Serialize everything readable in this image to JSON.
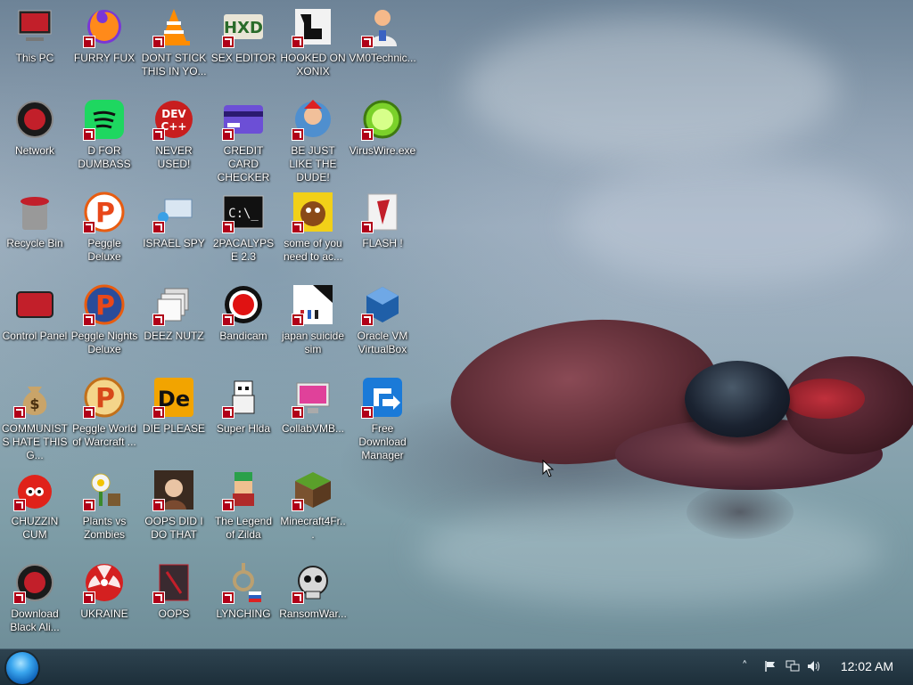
{
  "desktop": {
    "icons": [
      {
        "label": "This PC",
        "icon": "computer-icon"
      },
      {
        "label": "FURRY FUX",
        "icon": "firefox-icon"
      },
      {
        "label": "DONT STICK THIS IN YO...",
        "icon": "vlc-cone-icon"
      },
      {
        "label": "SEX EDITOR",
        "icon": "hxd-editor-icon"
      },
      {
        "label": "HOOKED ON XONIX",
        "icon": "xonix-game-icon"
      },
      {
        "label": "VM0Technic...",
        "icon": "technician-person-icon"
      },
      {
        "label": "Network",
        "icon": "network-orb-icon"
      },
      {
        "label": "D FOR DUMBASS",
        "icon": "spotify-icon"
      },
      {
        "label": "NEVER USED!",
        "icon": "devcpp-icon"
      },
      {
        "label": "CREDIT CARD CHECKER",
        "icon": "credit-card-icon"
      },
      {
        "label": "BE JUST LIKE THE DUDE!",
        "icon": "bonzi-globe-icon"
      },
      {
        "label": "VirusWire.exe",
        "icon": "limewire-icon"
      },
      {
        "label": "Recycle Bin",
        "icon": "recycle-bin-icon"
      },
      {
        "label": "Peggle Deluxe",
        "icon": "peggle-icon"
      },
      {
        "label": "ISRAEL SPY",
        "icon": "remote-desktop-icon"
      },
      {
        "label": "2PACALYPSE 2.3",
        "icon": "terminal-icon"
      },
      {
        "label": "some of you need to ac...",
        "icon": "dog-icon"
      },
      {
        "label": "FLASH !",
        "icon": "flash-icon"
      },
      {
        "label": "Control Panel",
        "icon": "control-panel-icon"
      },
      {
        "label": "Peggle Nights Deluxe",
        "icon": "peggle-nights-icon"
      },
      {
        "label": "DEEZ NUTZ",
        "icon": "windows-stack-icon"
      },
      {
        "label": "Bandicam",
        "icon": "bandicam-icon"
      },
      {
        "label": "japan suicide sim",
        "icon": "game-cover-icon"
      },
      {
        "label": "Oracle VM VirtualBox",
        "icon": "virtualbox-icon"
      },
      {
        "label": "COMMUNISTS HATE THIS G...",
        "icon": "money-bag-icon"
      },
      {
        "label": "Peggle World of Warcraft ...",
        "icon": "peggle-wow-icon"
      },
      {
        "label": "DIE PLEASE",
        "icon": "de-app-icon"
      },
      {
        "label": "Super Hlda",
        "icon": "pixel-character-icon"
      },
      {
        "label": "CollabVMB...",
        "icon": "monitor-app-icon"
      },
      {
        "label": "Free Download Manager",
        "icon": "download-manager-icon"
      },
      {
        "label": "CHUZZIN CUM",
        "icon": "chuzzle-icon"
      },
      {
        "label": "Plants vs Zombies",
        "icon": "plants-vs-zombies-icon"
      },
      {
        "label": "OOPS DID I DO THAT",
        "icon": "portrait-icon"
      },
      {
        "label": "The Legend of Zilda",
        "icon": "pixel-hero-icon"
      },
      {
        "label": "Minecraft4Fr...",
        "icon": "minecraft-block-icon"
      },
      {
        "label": "Download Black Ali...",
        "icon": "network-orb-icon"
      },
      {
        "label": "UKRAINE",
        "icon": "radiation-icon"
      },
      {
        "label": "OOPS",
        "icon": "dark-app-icon"
      },
      {
        "label": "LYNCHING",
        "icon": "noose-flag-icon"
      },
      {
        "label": "RansomWar...",
        "icon": "skull-icon"
      }
    ]
  },
  "taskbar": {
    "start_icon": "start-orb-icon",
    "tray": [
      "chevron-up-icon",
      "flag-icon",
      "network-tray-icon",
      "volume-icon"
    ],
    "clock": "12:02 AM"
  },
  "colors": {
    "taskbar": "#1d2f3a",
    "label_text": "#ffffff",
    "shortcut_badge": "#b00018"
  }
}
